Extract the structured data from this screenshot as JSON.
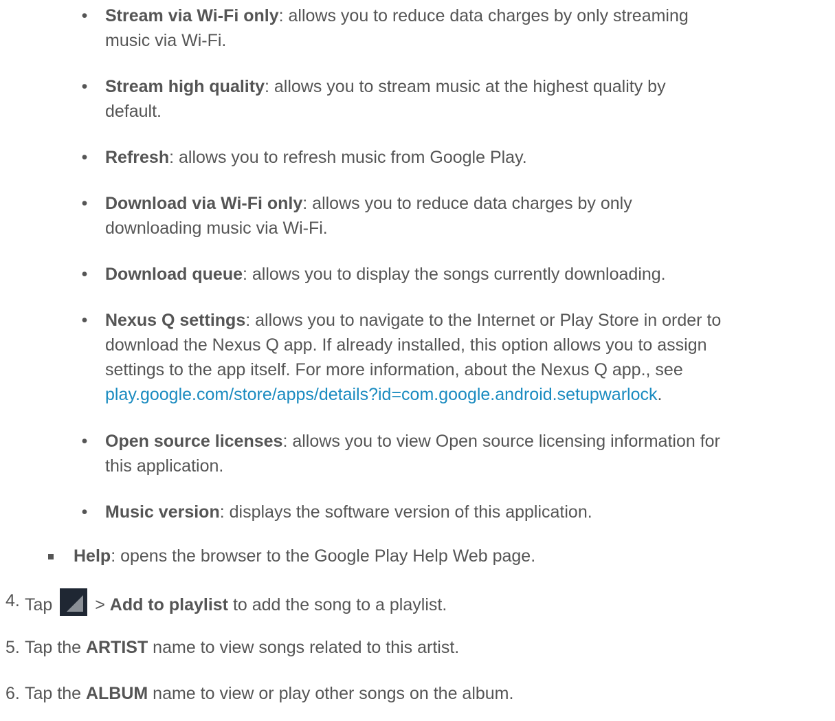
{
  "bullets": [
    {
      "term": "Stream via Wi-Fi only",
      "line1": ": allows you to reduce data charges by only streaming",
      "line2": "music via Wi-Fi."
    },
    {
      "term": "Stream high quality",
      "line1": ": allows you to stream music at the highest quality by",
      "line2": "default."
    },
    {
      "term": "Refresh",
      "line1": ": allows you to refresh music from Google Play."
    },
    {
      "term": "Download via Wi-Fi only",
      "line1": ": allows you to reduce data charges by only",
      "line2": "downloading music via Wi-Fi."
    },
    {
      "term": "Download queue",
      "line1": ": allows you to display the songs currently downloading."
    },
    {
      "term": "Nexus Q settings",
      "line1": ": allows you to navigate to the Internet or Play Store in order to",
      "line2": "download the Nexus Q app. If already installed, this option allows you to assign",
      "line3": "settings to the app itself. For more information, about the Nexus Q app., see",
      "link": "play.google.com/store/apps/details?id=com.google.android.setupwarlock",
      "after_link": "."
    },
    {
      "term": "Open source licenses",
      "line1": ": allows you to view Open source licensing information for",
      "line2": "this application."
    },
    {
      "term": "Music version",
      "line1": ": displays the software version of this application."
    }
  ],
  "help": {
    "term": "Help",
    "text": ": opens the browser to the Google Play Help Web page."
  },
  "steps": [
    {
      "num": "4.",
      "pre": "Tap",
      "mid": " > ",
      "bold": "Add to playlist",
      "post": " to add the song to a playlist."
    },
    {
      "num": "5.",
      "pre": "Tap the ",
      "bold": "ARTIST",
      "post": " name to view songs related to this artist."
    },
    {
      "num": "6.",
      "pre": "Tap the ",
      "bold": "ALBUM",
      "post": " name to view or play other songs on the album."
    }
  ],
  "icon": "menu-overflow-icon",
  "colors": {
    "text": "#555555",
    "link": "#1a8bc0",
    "icon_bg": "#1f2733"
  }
}
